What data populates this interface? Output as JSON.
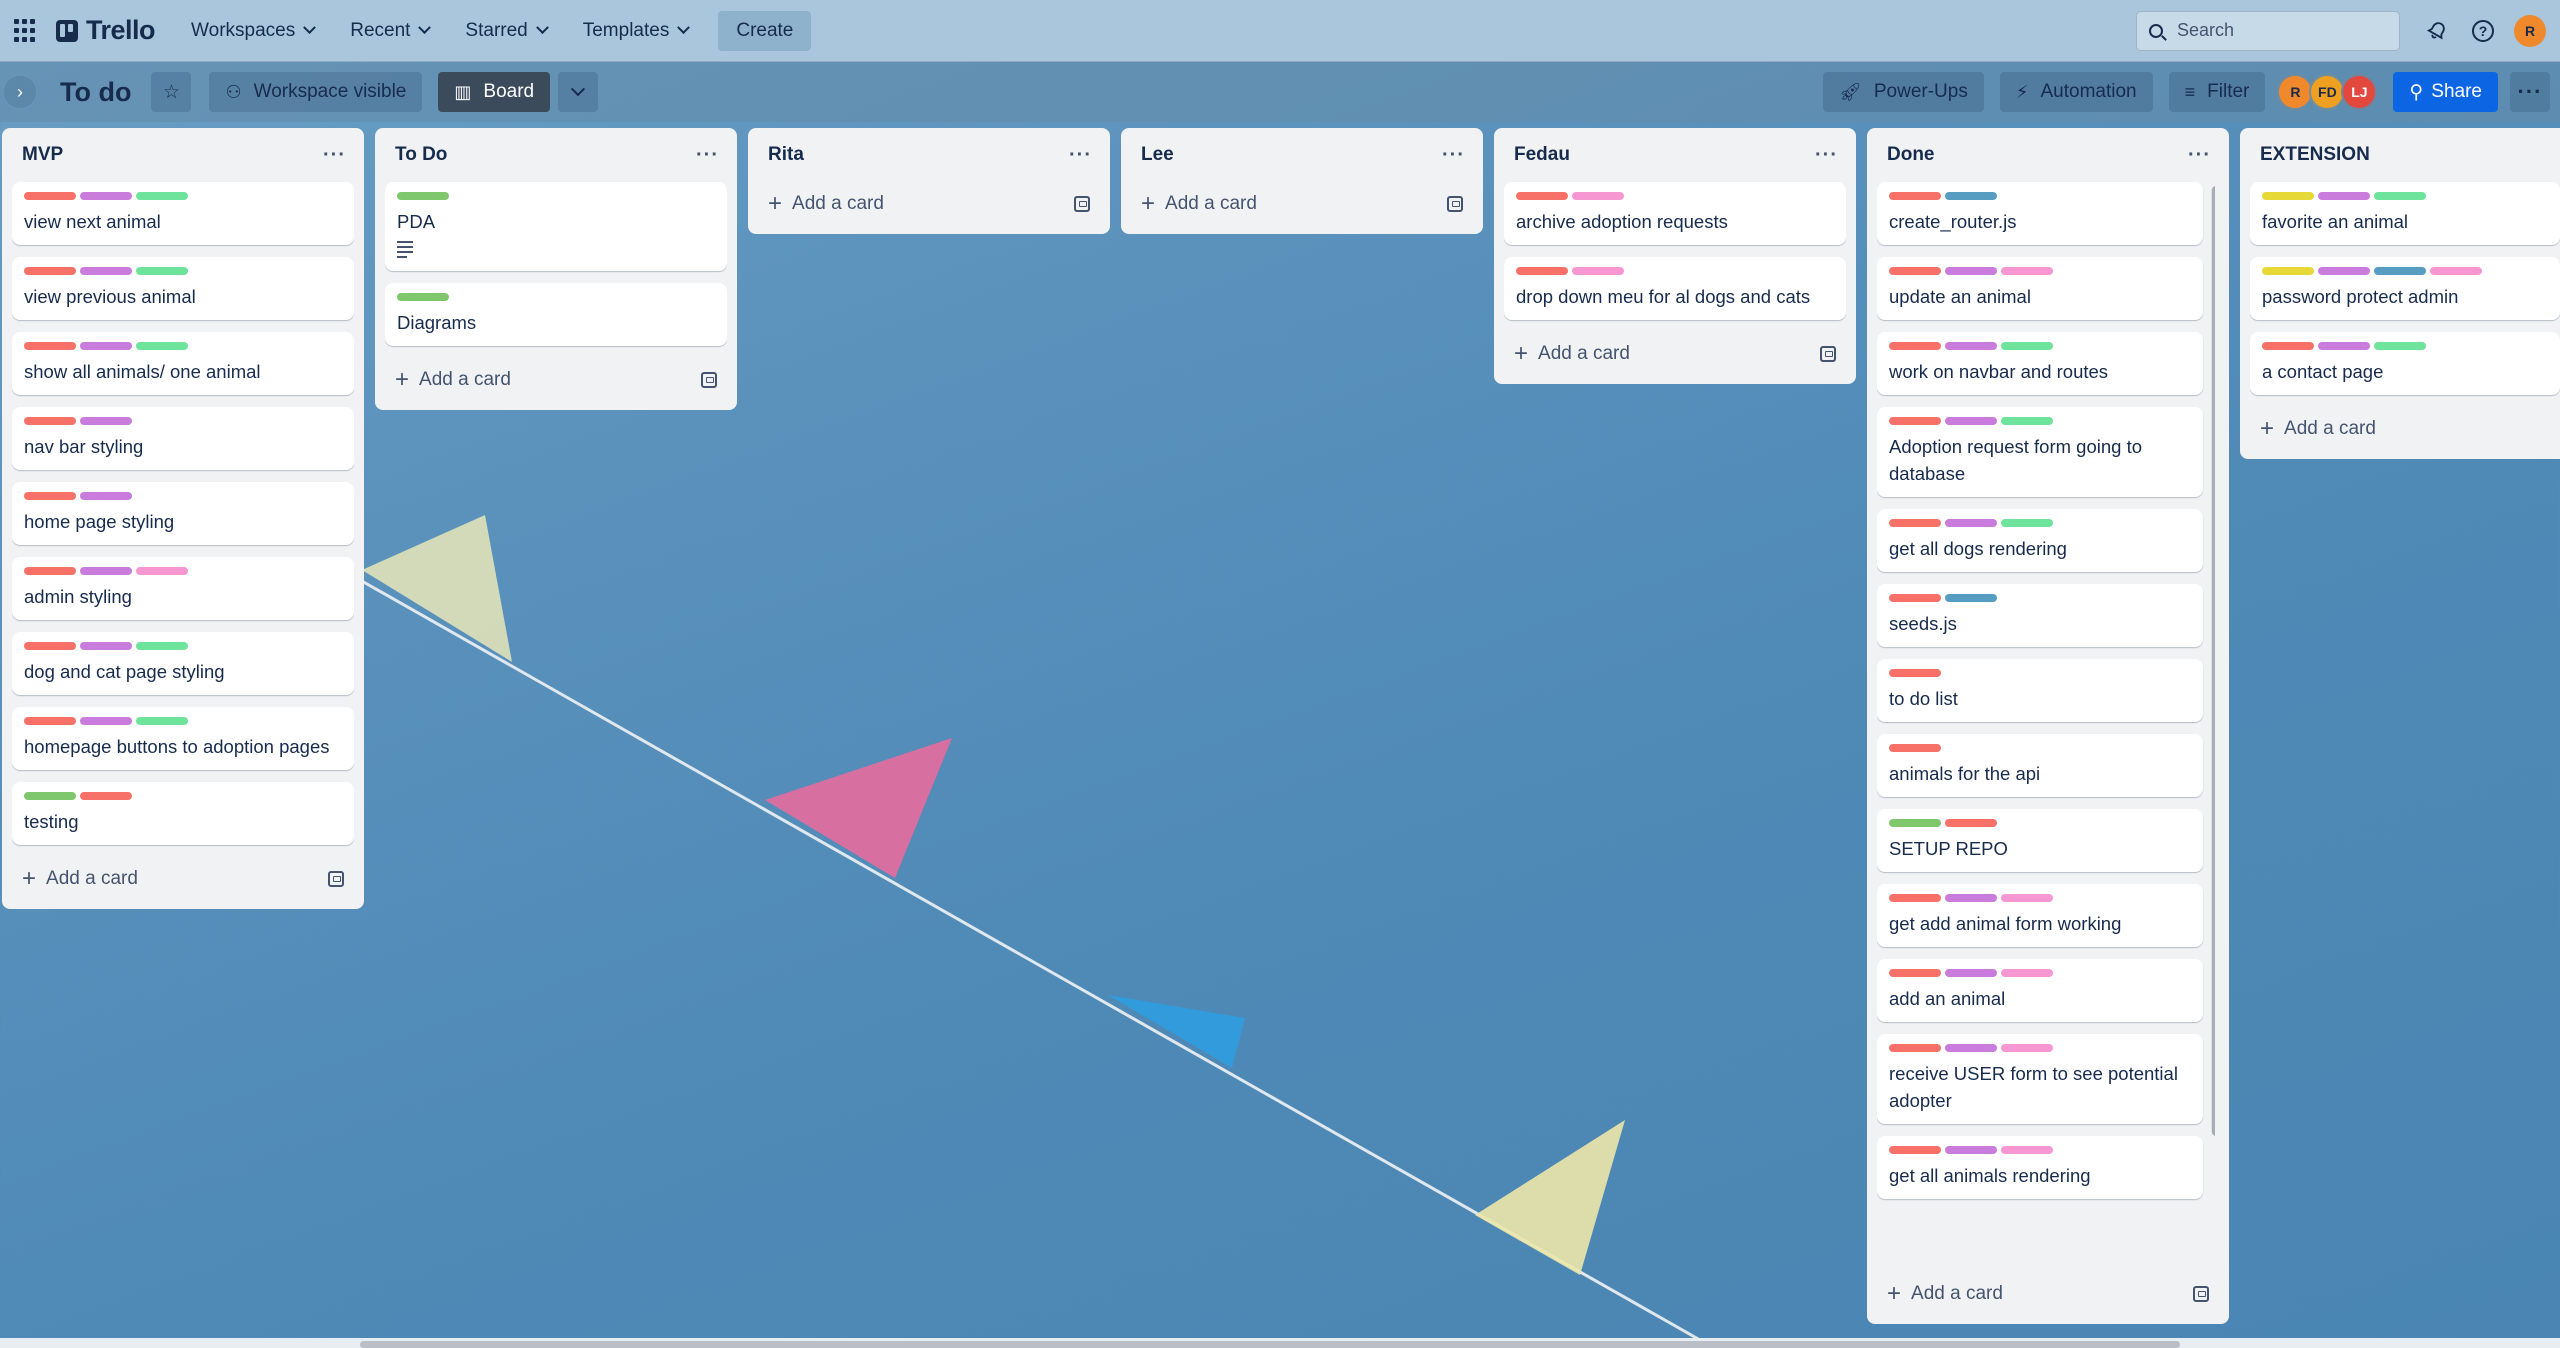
{
  "topnav": {
    "apps_icon": "grid-apps-icon",
    "logo_text": "Trello",
    "menus": [
      {
        "label": "Workspaces"
      },
      {
        "label": "Recent"
      },
      {
        "label": "Starred"
      },
      {
        "label": "Templates"
      }
    ],
    "create_label": "Create",
    "search_placeholder": "Search",
    "user_initial": "R"
  },
  "board_header": {
    "title": "To do",
    "visibility_label": "Workspace visible",
    "view_label": "Board",
    "powerups_label": "Power-Ups",
    "automation_label": "Automation",
    "filter_label": "Filter",
    "members": [
      {
        "initials": "R",
        "color": "#f0892c"
      },
      {
        "initials": "FD",
        "color": "#f0a020"
      },
      {
        "initials": "LJ",
        "color": "#e2483d"
      }
    ],
    "share_label": "Share"
  },
  "colors": {
    "red": "#f87168",
    "purple": "#c97cdb",
    "green": "#6ee39b",
    "lime": "#7ec76c",
    "pink": "#f797d2",
    "blue": "#579dc2",
    "yellow": "#e6d837"
  },
  "add_card_label": "Add a card",
  "lists": [
    {
      "title": "MVP",
      "cards": [
        {
          "title": "view next animal",
          "labels": [
            "red",
            "purple",
            "green"
          ]
        },
        {
          "title": "view previous animal",
          "labels": [
            "red",
            "purple",
            "green"
          ]
        },
        {
          "title": "show all animals/ one animal",
          "labels": [
            "red",
            "purple",
            "green"
          ]
        },
        {
          "title": "nav bar styling",
          "labels": [
            "red",
            "purple"
          ]
        },
        {
          "title": "home page styling",
          "labels": [
            "red",
            "purple"
          ]
        },
        {
          "title": "admin styling",
          "labels": [
            "red",
            "purple",
            "pink"
          ]
        },
        {
          "title": "dog and cat page styling",
          "labels": [
            "red",
            "purple",
            "green"
          ]
        },
        {
          "title": "homepage buttons to adoption pages",
          "labels": [
            "red",
            "purple",
            "green"
          ]
        },
        {
          "title": "testing",
          "labels": [
            "lime",
            "red"
          ]
        }
      ]
    },
    {
      "title": "To Do",
      "cards": [
        {
          "title": "PDA",
          "labels": [
            "lime"
          ],
          "has_description": true
        },
        {
          "title": "Diagrams",
          "labels": [
            "lime"
          ]
        }
      ]
    },
    {
      "title": "Rita",
      "cards": []
    },
    {
      "title": "Lee",
      "cards": []
    },
    {
      "title": "Fedau",
      "cards": [
        {
          "title": "archive adoption requests",
          "labels": [
            "red",
            "pink"
          ]
        },
        {
          "title": "drop down meu for al dogs and cats",
          "labels": [
            "red",
            "pink"
          ]
        }
      ]
    },
    {
      "title": "Done",
      "cards": [
        {
          "title": "create_router.js",
          "labels": [
            "red",
            "blue"
          ]
        },
        {
          "title": "update an animal",
          "labels": [
            "red",
            "purple",
            "pink"
          ]
        },
        {
          "title": "work on navbar and routes",
          "labels": [
            "red",
            "purple",
            "green"
          ]
        },
        {
          "title": "Adoption request form going to database",
          "labels": [
            "red",
            "purple",
            "green"
          ]
        },
        {
          "title": "get all dogs rendering",
          "labels": [
            "red",
            "purple",
            "green"
          ]
        },
        {
          "title": "seeds.js",
          "labels": [
            "red",
            "blue"
          ]
        },
        {
          "title": "to do list",
          "labels": [
            "red"
          ]
        },
        {
          "title": "animals for the api",
          "labels": [
            "red"
          ]
        },
        {
          "title": "SETUP REPO",
          "labels": [
            "lime",
            "red"
          ]
        },
        {
          "title": "get add animal form working",
          "labels": [
            "red",
            "purple",
            "pink"
          ]
        },
        {
          "title": "add an animal",
          "labels": [
            "red",
            "purple",
            "pink"
          ]
        },
        {
          "title": "receive USER form to see potential adopter",
          "labels": [
            "red",
            "purple",
            "pink"
          ]
        },
        {
          "title": "get all animals rendering",
          "labels": [
            "red",
            "purple",
            "pink"
          ]
        }
      ]
    },
    {
      "title": "EXTENSION",
      "cards": [
        {
          "title": "favorite an animal",
          "labels": [
            "yellow",
            "purple",
            "green"
          ]
        },
        {
          "title": "password protect admin",
          "labels": [
            "yellow",
            "purple",
            "blue",
            "pink"
          ]
        },
        {
          "title": "a contact page",
          "labels": [
            "red",
            "purple",
            "green"
          ]
        }
      ]
    }
  ]
}
